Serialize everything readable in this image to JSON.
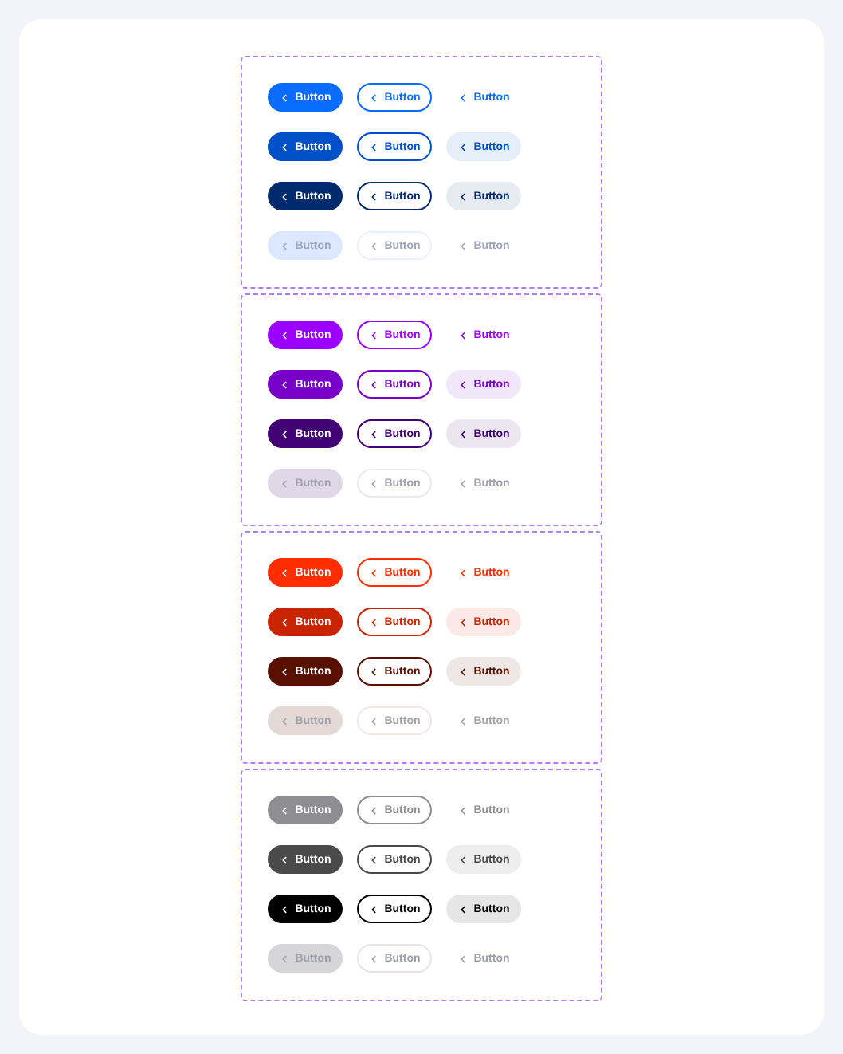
{
  "sections": [
    {
      "rows": [
        {
          "kind": "default",
          "color": "#0a6cff",
          "buttons": [
            {
              "kind": "filled",
              "label": "Button"
            },
            {
              "kind": "outline",
              "label": "Button"
            },
            {
              "kind": "ghost",
              "label": "Button"
            }
          ]
        },
        {
          "kind": "hover",
          "color": "#0050c8",
          "buttons": [
            {
              "kind": "filled",
              "label": "Button"
            },
            {
              "kind": "outline",
              "label": "Button"
            },
            {
              "kind": "ghost",
              "label": "Button"
            }
          ]
        },
        {
          "kind": "pressed",
          "color": "#002a6e",
          "buttons": [
            {
              "kind": "filled",
              "label": "Button"
            },
            {
              "kind": "outline",
              "label": "Button"
            },
            {
              "kind": "ghost",
              "label": "Button"
            }
          ]
        },
        {
          "kind": "disabled",
          "color": "#dbe8ff",
          "buttons": [
            {
              "kind": "filled",
              "label": "Button"
            },
            {
              "kind": "outline",
              "label": "Button"
            },
            {
              "kind": "ghost",
              "label": "Button"
            }
          ]
        }
      ]
    },
    {
      "rows": [
        {
          "kind": "default",
          "color": "#9b00ff",
          "buttons": [
            {
              "kind": "filled",
              "label": "Button"
            },
            {
              "kind": "outline",
              "label": "Button"
            },
            {
              "kind": "ghost",
              "label": "Button"
            }
          ]
        },
        {
          "kind": "hover",
          "color": "#7800c8",
          "buttons": [
            {
              "kind": "filled",
              "label": "Button"
            },
            {
              "kind": "outline",
              "label": "Button"
            },
            {
              "kind": "ghost",
              "label": "Button"
            }
          ]
        },
        {
          "kind": "pressed",
          "color": "#410074",
          "buttons": [
            {
              "kind": "filled",
              "label": "Button"
            },
            {
              "kind": "outline",
              "label": "Button"
            },
            {
              "kind": "ghost",
              "label": "Button"
            }
          ]
        },
        {
          "kind": "disabled",
          "color": "#e0d8e6",
          "buttons": [
            {
              "kind": "filled",
              "label": "Button"
            },
            {
              "kind": "outline",
              "label": "Button"
            },
            {
              "kind": "ghost",
              "label": "Button"
            }
          ]
        }
      ]
    },
    {
      "rows": [
        {
          "kind": "default",
          "color": "#ff2d00",
          "buttons": [
            {
              "kind": "filled",
              "label": "Button"
            },
            {
              "kind": "outline",
              "label": "Button"
            },
            {
              "kind": "ghost",
              "label": "Button"
            }
          ]
        },
        {
          "kind": "hover",
          "color": "#c82400",
          "buttons": [
            {
              "kind": "filled",
              "label": "Button"
            },
            {
              "kind": "outline",
              "label": "Button"
            },
            {
              "kind": "ghost",
              "label": "Button"
            }
          ]
        },
        {
          "kind": "pressed",
          "color": "#5a1000",
          "buttons": [
            {
              "kind": "filled",
              "label": "Button"
            },
            {
              "kind": "outline",
              "label": "Button"
            },
            {
              "kind": "ghost",
              "label": "Button"
            }
          ]
        },
        {
          "kind": "disabled",
          "color": "#e4d9d6",
          "buttons": [
            {
              "kind": "filled",
              "label": "Button"
            },
            {
              "kind": "outline",
              "label": "Button"
            },
            {
              "kind": "ghost",
              "label": "Button"
            }
          ]
        }
      ]
    },
    {
      "rows": [
        {
          "kind": "default",
          "color": "#8e8e93",
          "buttons": [
            {
              "kind": "filled",
              "label": "Button"
            },
            {
              "kind": "outline",
              "label": "Button"
            },
            {
              "kind": "ghost",
              "label": "Button"
            }
          ]
        },
        {
          "kind": "hover",
          "color": "#4a4a4a",
          "buttons": [
            {
              "kind": "filled",
              "label": "Button"
            },
            {
              "kind": "outline",
              "label": "Button"
            },
            {
              "kind": "ghost",
              "label": "Button"
            }
          ]
        },
        {
          "kind": "pressed",
          "color": "#000000",
          "buttons": [
            {
              "kind": "filled",
              "label": "Button"
            },
            {
              "kind": "outline",
              "label": "Button"
            },
            {
              "kind": "ghost",
              "label": "Button"
            }
          ]
        },
        {
          "kind": "disabled",
          "color": "#d6d6d8",
          "buttons": [
            {
              "kind": "filled",
              "label": "Button"
            },
            {
              "kind": "outline",
              "label": "Button"
            },
            {
              "kind": "ghost",
              "label": "Button"
            }
          ]
        }
      ]
    }
  ]
}
